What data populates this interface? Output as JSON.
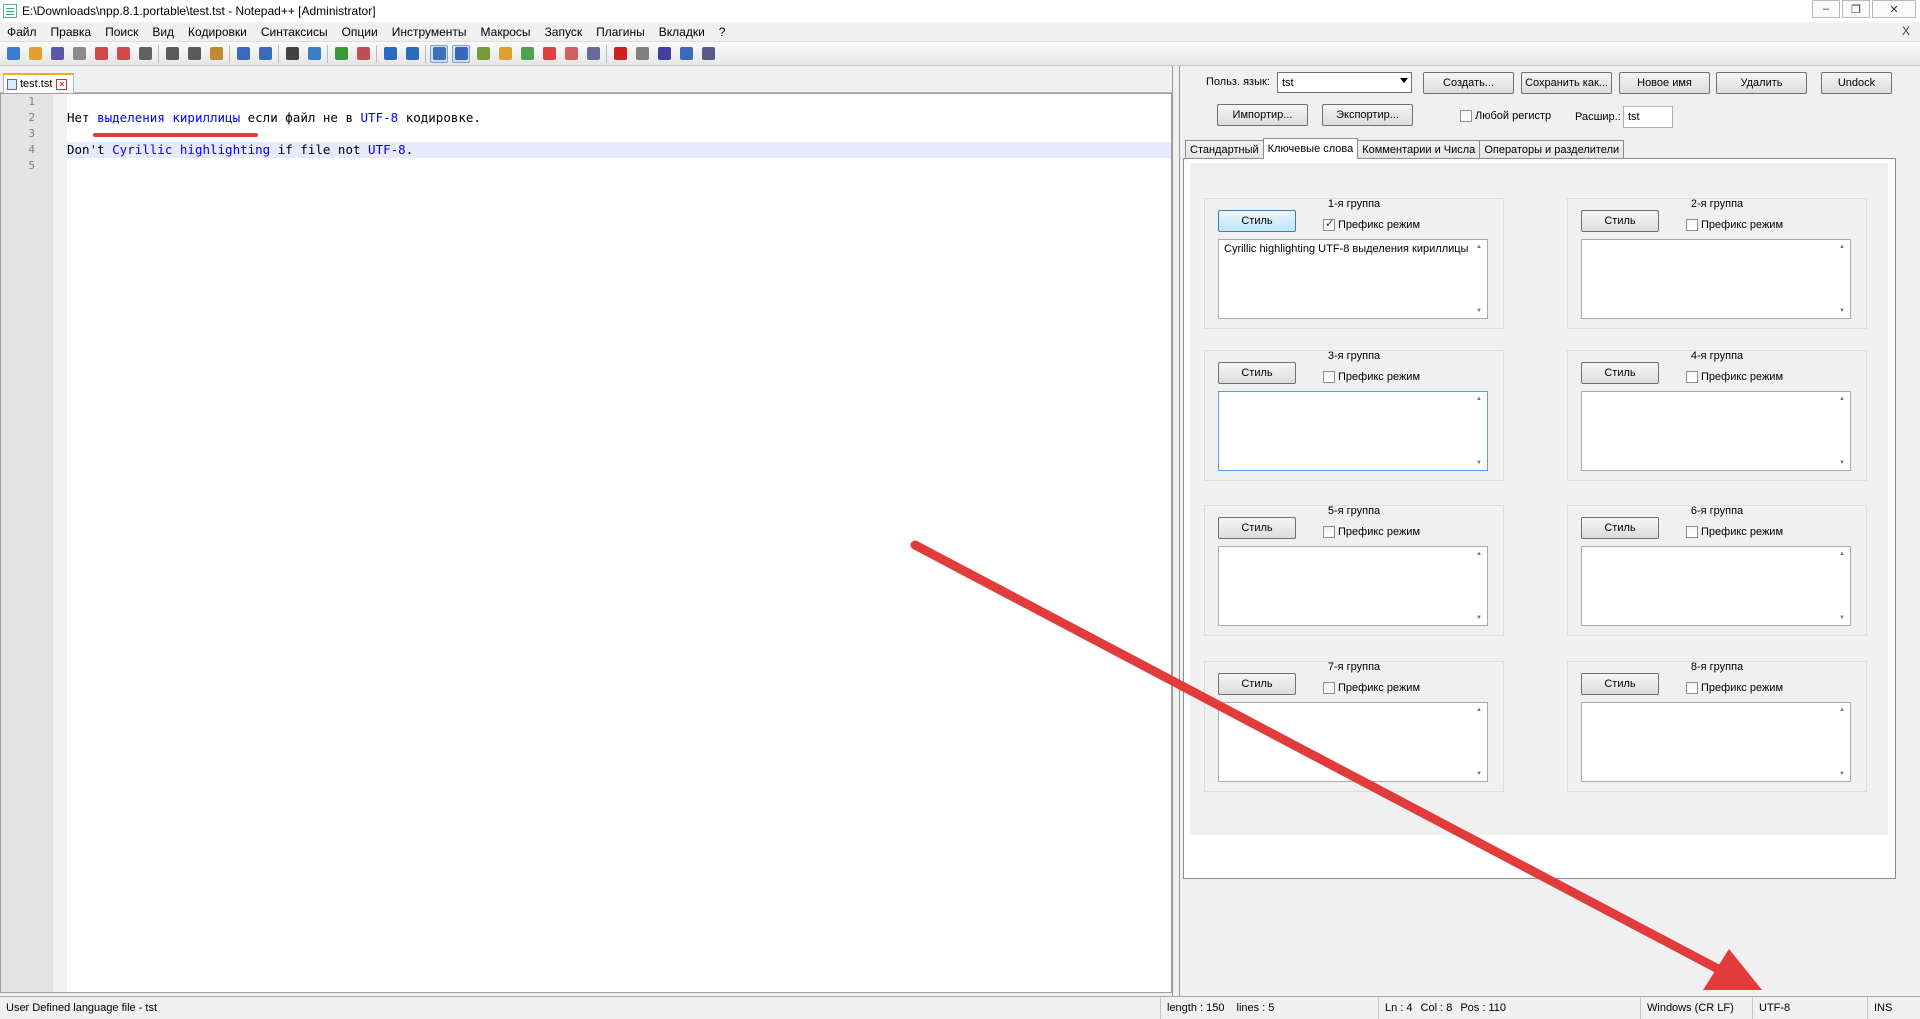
{
  "window": {
    "title": "E:\\Downloads\\npp.8.1.portable\\test.tst - Notepad++ [Administrator]",
    "controls": [
      "–",
      "❐",
      "✕"
    ]
  },
  "menu": {
    "items": [
      "Файл",
      "Правка",
      "Поиск",
      "Вид",
      "Кодировки",
      "Синтаксисы",
      "Опции",
      "Инструменты",
      "Макросы",
      "Запуск",
      "Плагины",
      "Вкладки",
      "?"
    ],
    "close": "X"
  },
  "toolbar": {
    "buttons": [
      "new-file-icon",
      "open-file-icon",
      "save-icon",
      "save-all-icon",
      "close-icon",
      "close-all-icon",
      "print-icon",
      "cut-icon",
      "copy-icon",
      "paste-icon",
      "undo-icon",
      "redo-icon",
      "find-icon",
      "replace-icon",
      "zoom-in-icon",
      "zoom-out-icon",
      "sync-vertical-icon",
      "sync-horizontal-icon",
      "word-wrap-icon",
      "show-all-chars-icon",
      "indent-guide-icon",
      "udl-icon",
      "doc-map-icon",
      "function-list-icon",
      "folder-workspace-icon",
      "monitoring-icon",
      "record-macro-icon",
      "stop-macro-icon",
      "play-macro-icon",
      "run-macro-multiple-icon",
      "save-macro-icon"
    ]
  },
  "editor": {
    "tab_label": "test.tst",
    "line_numbers": [
      "1",
      "2",
      "3",
      "4",
      "5"
    ],
    "line2": {
      "t1": "Нет ",
      "t2": "выделения кириллицы",
      "t3": " если файл не в ",
      "t4": "UTF-8",
      "t5": " кодировке."
    },
    "line4": {
      "t1": "Don't ",
      "t2": "Cyrillic highlighting",
      "t3": " if file not ",
      "t4": "UTF-8",
      "t5": "."
    }
  },
  "udl": {
    "lang_label": "Польз. язык:",
    "lang_value": "tst",
    "btn_create": "Создать...",
    "btn_save_as": "Сохранить как...",
    "btn_rename": "Новое имя",
    "btn_remove": "Удалить",
    "btn_undock": "Undock",
    "btn_import": "Импортир...",
    "btn_export": "Экспортир...",
    "ignore_case_label": "Любой регистр",
    "ignore_case_checked": false,
    "ext_label": "Расшир.:",
    "ext_value": "tst",
    "tabs": [
      "Стандартный",
      "Ключевые слова",
      "Комментарии и Числа",
      "Операторы и разделители"
    ],
    "active_tab": 1,
    "style_label": "Стиль",
    "prefix_label": "Префикс режим",
    "groups": [
      {
        "title": "1-я группа",
        "prefix": true,
        "keywords": "Cyrillic highlighting UTF-8 выделения кириллицы"
      },
      {
        "title": "2-я группа",
        "prefix": false,
        "keywords": ""
      },
      {
        "title": "3-я группа",
        "prefix": false,
        "keywords": ""
      },
      {
        "title": "4-я группа",
        "prefix": false,
        "keywords": ""
      },
      {
        "title": "5-я группа",
        "prefix": false,
        "keywords": ""
      },
      {
        "title": "6-я группа",
        "prefix": false,
        "keywords": ""
      },
      {
        "title": "7-я группа",
        "prefix": false,
        "keywords": ""
      },
      {
        "title": "8-я группа",
        "prefix": false,
        "keywords": ""
      }
    ]
  },
  "status": {
    "file_type": "User Defined language file - tst",
    "length": "length : 150",
    "lines": "lines : 5",
    "ln": "Ln : 4",
    "col": "Col : 8",
    "pos": "Pos : 110",
    "eol": "Windows (CR LF)",
    "encoding": "UTF-8",
    "mode": "INS"
  },
  "colors": {
    "keyword": "#0000ff",
    "annotation": "#e23b3b",
    "current_line": "#e8e8ff"
  }
}
